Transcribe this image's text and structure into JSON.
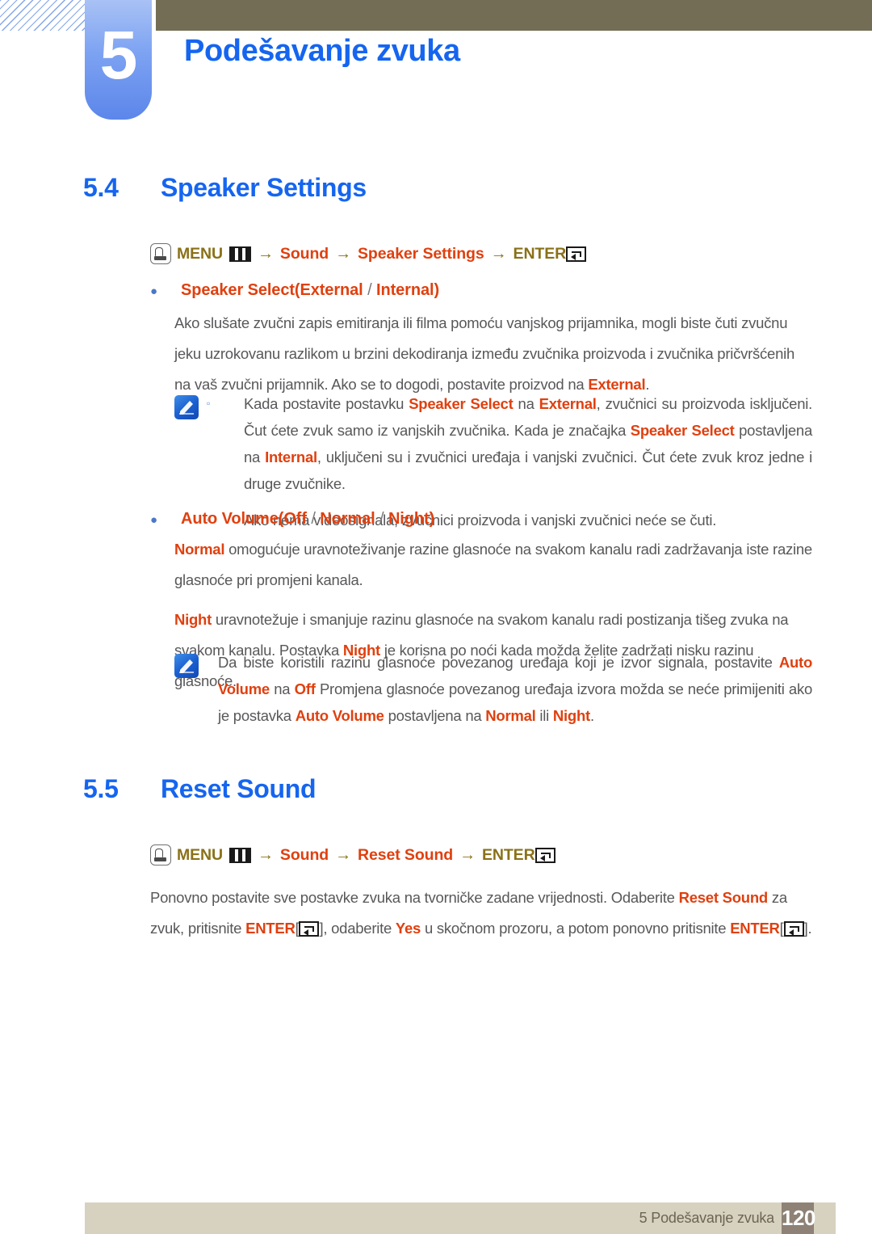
{
  "header": {
    "chapter_number": "5",
    "chapter_title": "Podešavanje zvuka",
    "accent_blue": "#1565f0",
    "olive": "#726d54"
  },
  "sections": [
    {
      "number": "5.4",
      "title": "Speaker Settings",
      "path": {
        "menu_label": "MENU",
        "arrow": "→",
        "items": [
          "Sound",
          "Speaker Settings"
        ],
        "enter_label": "ENTER"
      },
      "bullet1": {
        "name": "Speaker Select",
        "open_paren": "(",
        "opt1": "External",
        "sep": " / ",
        "opt2": "Internal",
        "close_paren": ")"
      },
      "para1": {
        "a": "Ako slušate zvučni zapis emitiranja ili filma pomoću vanjskog prijamnika, mogli biste čuti zvučnu jeku uzrokovanu razlikom u brzini dekodiranja između zvučnika proizvoda i zvučnika pričvršćenih na vaš zvučni prijamnik. Ako se to dogodi, postavite proizvod na ",
        "hl1": "External",
        "b": "."
      },
      "note1": {
        "bullet_mark": "▫",
        "l1_a": "Kada postavite postavku ",
        "l1_hl1": "Speaker Select",
        "l1_b": " na ",
        "l1_hl2": "External",
        "l1_c": ", zvučnici su proizvoda isključeni. Čut ćete zvuk samo iz vanjskih zvučnika. Kada je značajka ",
        "l1_hl3": "Speaker Select",
        "l1_d": " postavljena na ",
        "l1_hl4": "Internal",
        "l1_e": ", uključeni su i zvučnici uređaja i vanjski zvučnici. Čut ćete zvuk kroz jedne i druge zvučnike.",
        "l2": "Ako nema videosignala, zvučnici proizvoda i vanjski zvučnici neće se čuti."
      },
      "bullet2": {
        "name": "Auto Volume",
        "open_paren": "(",
        "opt1": "Off",
        "sep1": " / ",
        "opt2": "Normal",
        "sep2": " / ",
        "opt3": "Night",
        "close_paren": ")"
      },
      "para2": {
        "hl1": "Normal",
        "a": " omogućuje uravnoteživanje razine glasnoće na svakom kanalu radi zadržavanja iste razine glasnoće pri promjeni kanala."
      },
      "para3": {
        "hl1": "Night",
        "a": " uravnotežuje i smanjuje razinu glasnoće na svakom kanalu radi postizanja tišeg zvuka na svakom kanalu. Postavka ",
        "hl2": "Night",
        "b": " je korisna po noći kada možda želite zadržati nisku razinu glasnoće."
      },
      "note2": {
        "a": "Da biste koristili razinu glasnoće povezanog uređaja koji je izvor signala, postavite ",
        "hl1": "Auto Volume",
        "b": " na ",
        "hl2": "Off",
        "c": " Promjena glasnoće povezanog uređaja izvora možda se neće primijeniti ako je postavka ",
        "hl3": "Auto Volume",
        "d": " postavljena na ",
        "hl4": "Normal",
        "e": " ili ",
        "hl5": "Night",
        "f": "."
      }
    },
    {
      "number": "5.5",
      "title": "Reset Sound",
      "path": {
        "menu_label": "MENU",
        "arrow": "→",
        "items": [
          "Sound",
          "Reset Sound"
        ],
        "enter_label": "ENTER"
      },
      "para1": {
        "a": "Ponovno postavite sve postavke zvuka na tvorničke zadane vrijednosti. Odaberite ",
        "hl1": "Reset Sound",
        "b": " za zvuk, pritisnite ",
        "hl2": "ENTER",
        "br_open": "[",
        "br_close": "]",
        "c": ", odaberite ",
        "hl3": "Yes",
        "d": " u skočnom prozoru, a potom ponovno pritisnite ",
        "hl4": "ENTER",
        "e": "."
      }
    }
  ],
  "footer": {
    "text": "5 Podešavanje zvuka",
    "page": "120",
    "bar_color": "#d7d2c0",
    "page_box_color": "#8e8175"
  }
}
